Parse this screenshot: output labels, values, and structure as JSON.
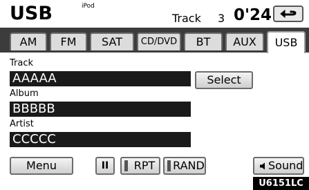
{
  "header": {
    "title": "USB",
    "subtitle": "iPod",
    "track_label": "Track",
    "track_number": "3",
    "time": "0'24\""
  },
  "tabs": [
    {
      "label": "AM"
    },
    {
      "label": "FM"
    },
    {
      "label": "SAT"
    },
    {
      "label": "CD/DVD"
    },
    {
      "label": "BT"
    },
    {
      "label": "AUX"
    },
    {
      "label": "USB",
      "active": true
    }
  ],
  "track": {
    "label": "Track",
    "value": "AAAAA",
    "select_label": "Select"
  },
  "album": {
    "label": "Album",
    "value": "BBBBB"
  },
  "artist": {
    "label": "Artist",
    "value": "CCCCC"
  },
  "controls": {
    "menu_label": "Menu",
    "pause_label": "II",
    "rpt_label": "RPT",
    "rand_label": "RAND",
    "sound_label": "Sound"
  },
  "figure_id": "U6151LC",
  "icons": [
    "back-arrow-icon",
    "speaker-icon"
  ]
}
